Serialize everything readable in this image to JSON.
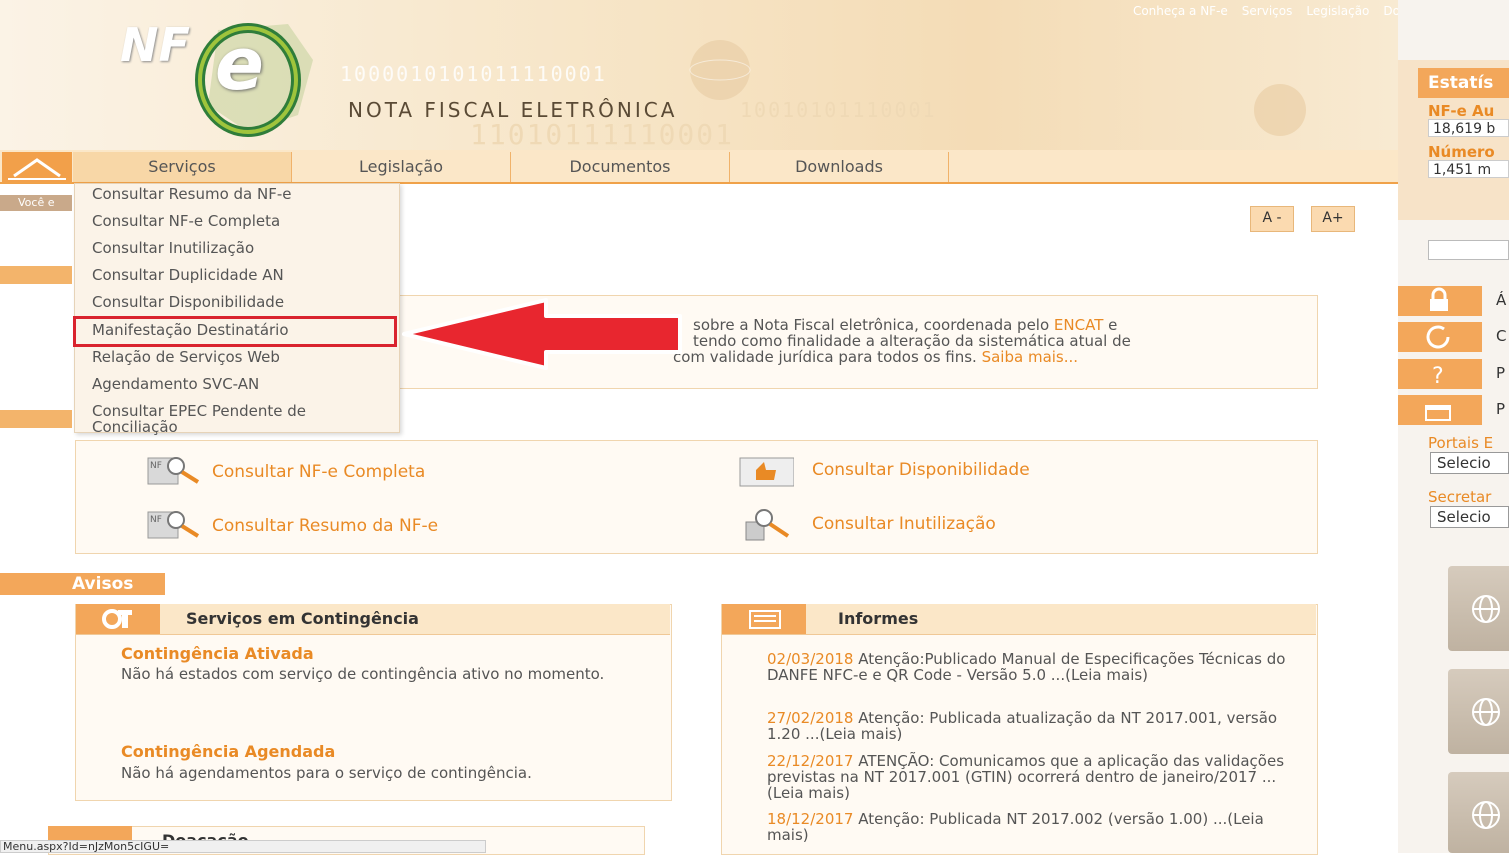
{
  "header": {
    "logo_text": "NF",
    "logo_letter": "e",
    "binary_1": "1000010101011110001",
    "binary_2": "10010101110001",
    "binary_3": "11010111110001",
    "site_title": "NOTA FISCAL ELETRÔNICA",
    "top_links": [
      "Conheça a NF-e",
      "Serviços",
      "Legislação",
      "Do"
    ]
  },
  "nav": {
    "tabs": [
      "Serviços",
      "Legislação",
      "Documentos",
      "Downloads"
    ]
  },
  "breadcrumb_prefix": "Você e",
  "dropdown": {
    "items": [
      "Consultar Resumo da NF-e",
      "Consultar NF-e Completa",
      "Consultar Inutilização",
      "Consultar Duplicidade AN",
      "Consultar Disponibilidade",
      "Manifestação Destinatário",
      "Relação de Serviços Web",
      "Agendamento SVC-AN",
      "Consultar EPEC Pendente de Conciliação"
    ]
  },
  "font_controls": {
    "minus": "A -",
    "plus": "A+"
  },
  "intro": {
    "line1a": "sobre a Nota Fiscal eletrônica, coordenada pelo ",
    "line1_link": "ENCAT",
    "line1b": " e",
    "line2": "tendo como finalidade a alteração da sistemática atual de",
    "line3a": "com validade jurídica para todos os fins. ",
    "line3_link": "Saiba mais..."
  },
  "quick_links": {
    "nfe_completa": "Consultar NF-e Completa",
    "resumo": "Consultar Resumo da NF-e",
    "disponibilidade": "Consultar Disponibilidade",
    "inutilizacao": "Consultar Inutilização"
  },
  "avisos": {
    "title": "Avisos",
    "contingencia": {
      "title": "Serviços em Contingência",
      "ativada_title": "Contingência Ativada",
      "ativada_text": "Não há estados com serviço de contingência ativo no momento.",
      "agendada_title": "Contingência Agendada",
      "agendada_text": "Não há agendamentos para o serviço de contingência."
    },
    "informes": {
      "title": "Informes",
      "items": [
        {
          "date": "02/03/2018",
          "text": " Atenção:Publicado Manual de Especificações Técnicas do DANFE NFC-e e QR Code - Versão 5.0 ...(Leia mais)"
        },
        {
          "date": "27/02/2018",
          "text": " Atenção: Publicada atualização da NT 2017.001, versão 1.20 ...(Leia mais)"
        },
        {
          "date": "22/12/2017",
          "text": " ATENÇÃO: Comunicamos que a aplicação das validações previstas na NT 2017.001 (GTIN) ocorrerá dentro de janeiro/2017 ...(Leia mais)"
        },
        {
          "date": "18/12/2017",
          "text": " Atenção: Publicada NT 2017.002 (versão 1.00) ...(Leia mais)"
        }
      ]
    },
    "doacao_title": "Doacação"
  },
  "sidebar": {
    "stat_title": "Estatís",
    "nfe_label": "NF-e Au",
    "nfe_value": "18,619 b",
    "num_label": "Número",
    "num_value": "1,451 m",
    "btn_letters": [
      "Á",
      "C",
      "P",
      "P"
    ],
    "portais_label": "Portais E",
    "portais_select": "Selecio",
    "secret_label": "Secretar",
    "secret_select": "Selecio"
  },
  "statusbar": "Menu.aspx?Id=nJzMon5cIGU="
}
